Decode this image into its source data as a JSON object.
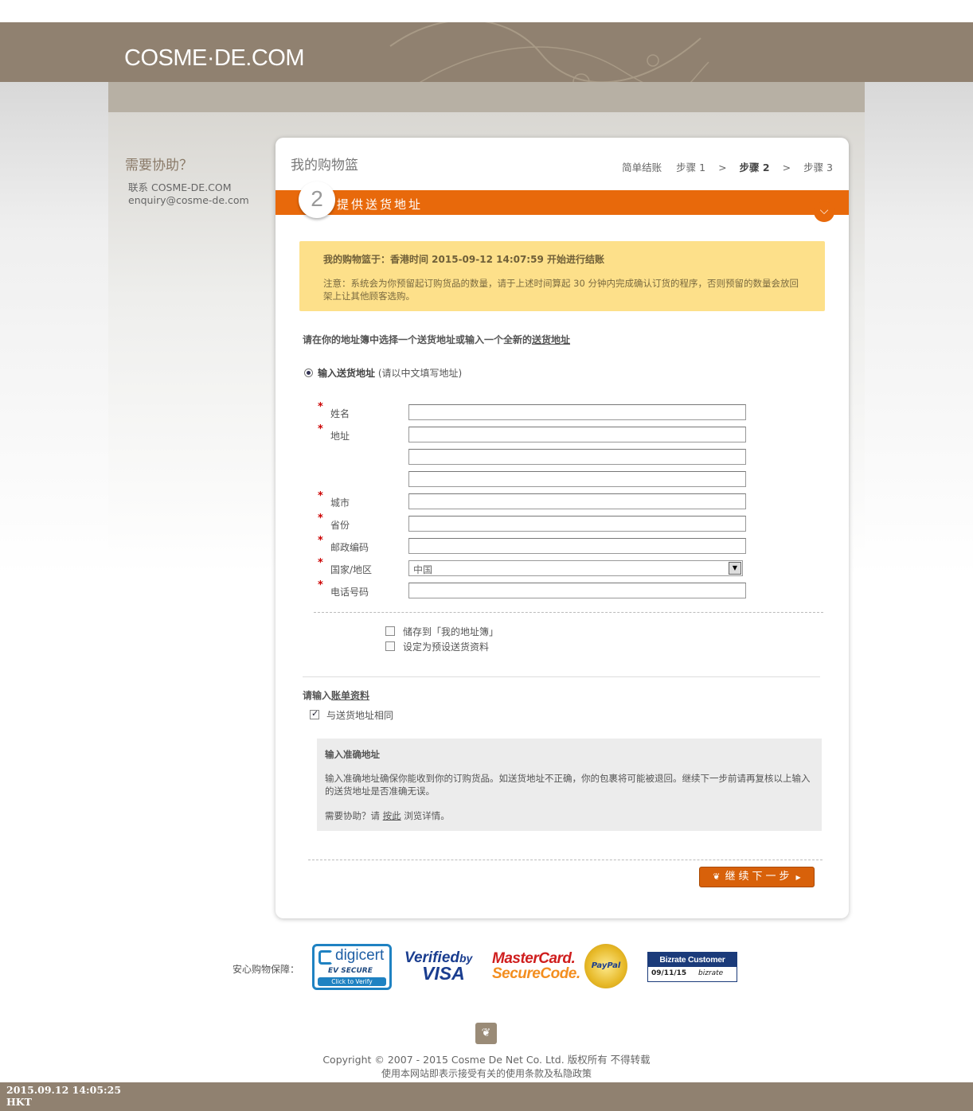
{
  "header": {
    "logo": "COSME·DE.COM"
  },
  "help": {
    "title": "需要协助？",
    "contact_label": "联系 COSME-DE.COM",
    "email": "enquiry@cosme-de.com"
  },
  "cart": {
    "title": "我的购物篮",
    "steps": {
      "simple": "简单结账",
      "step1": "步骤 1",
      "sep": ">",
      "step2": "步骤 2",
      "step3": "步骤 3"
    },
    "current_step_number": "2",
    "current_step_label": "提供送货地址"
  },
  "notice": {
    "line1": "我的购物篮于：香港时间 2015-09-12 14:07:59 开始进行结账",
    "line2": "注意：系统会为你预留起订购货品的数量，请于上述时间算起 30 分钟内完成确认订货的程序，否则预留的数量会放回架上让其他顾客选购。"
  },
  "address_choice": {
    "prefix": "请在你的地址簿中选择一个送货地址或输入一个全新的",
    "link": "送货地址"
  },
  "radio": {
    "label": "输入送货地址",
    "hint": "(请以中文填写地址)"
  },
  "form": {
    "name_label": "姓名",
    "address_label": "地址",
    "city_label": "城市",
    "province_label": "省份",
    "postcode_label": "邮政编码",
    "country_label": "国家/地区",
    "country_value": "中国",
    "phone_label": "电话号码",
    "required_mark": "*"
  },
  "options": {
    "save_address": "储存到「我的地址簿」",
    "set_default": "设定为预设送货资料"
  },
  "billing": {
    "title_prefix": "请输入",
    "title_link": "账单资料",
    "same_label": "与送货地址相同",
    "same_checked": true
  },
  "info": {
    "heading": "输入准确地址",
    "body": "输入准确地址确保你能收到你的订购货品。如送货地址不正确，你的包裹将可能被退回。继续下一步前请再复核以上输入的送货地址是否准确无误。",
    "help_prefix": "需要协助？请",
    "help_link": "按此",
    "help_suffix": "浏览详情。"
  },
  "next_button": "继续下一步",
  "security": {
    "label": "安心购物保障：",
    "digicert": {
      "brand": "digicert",
      "ev": "EV SECURE",
      "click": "Click to Verify"
    },
    "visa": {
      "verified": "Verified",
      "by": "by",
      "visa": "VISA"
    },
    "mastercard": {
      "line1": "MasterCard.",
      "line2": "SecureCode."
    },
    "paypal": "PayPal",
    "bizrate": {
      "title": "Bizrate Customer Certified",
      "date": "09/11/15",
      "brand": "bizrate"
    }
  },
  "footer": {
    "copyright": "Copyright © 2007 - 2015 Cosme De Net Co. Ltd. 版权所有 不得转载",
    "terms": "使用本网站即表示接受有关的使用条款及私隐政策"
  },
  "clock": {
    "datetime": "2015.09.12 14:05:25",
    "zone": "HKT"
  },
  "colors": {
    "brand_brown": "#908170",
    "accent_orange": "#e8690b",
    "notice_yellow": "#fde08a"
  }
}
